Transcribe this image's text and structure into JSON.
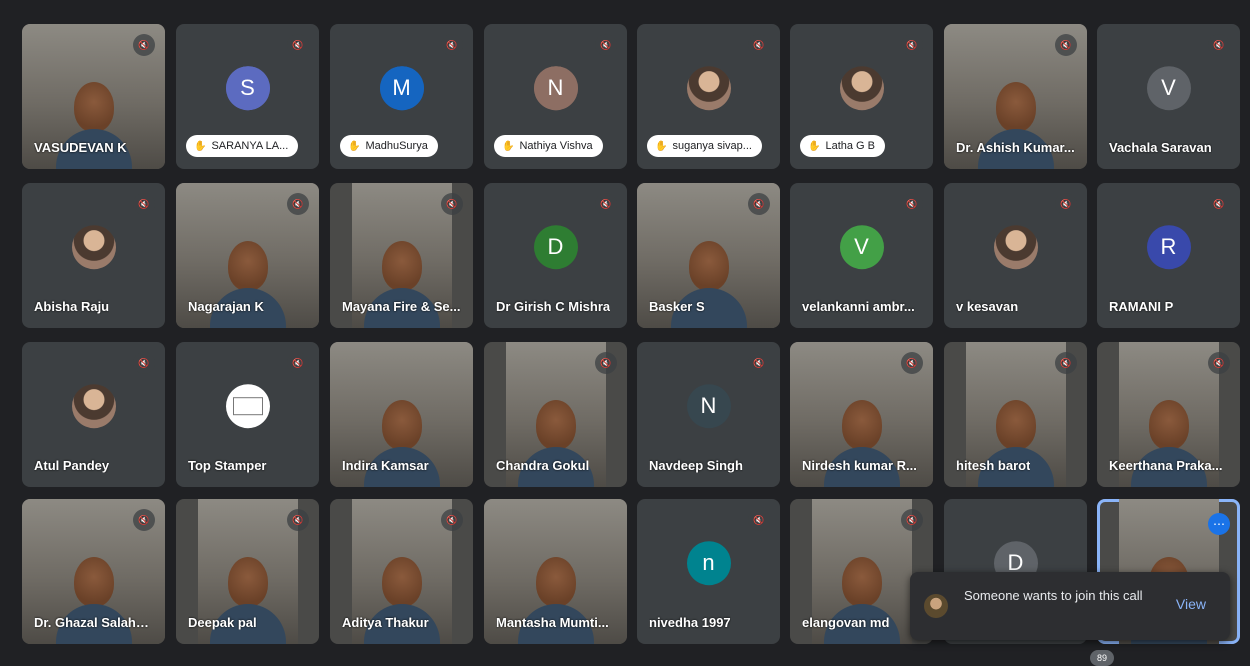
{
  "participants": [
    {
      "name": "VASUDEVAN K",
      "type": "video",
      "muted": true
    },
    {
      "name": "SARANYA LA...",
      "type": "pill",
      "initial": "S",
      "color": "#5c6bc0",
      "muted": true
    },
    {
      "name": "MadhuSurya",
      "type": "pill",
      "initial": "M",
      "color": "#1565c0",
      "muted": true
    },
    {
      "name": "Nathiya Vishva",
      "type": "pill",
      "initial": "N",
      "color": "#8d6e63",
      "muted": true
    },
    {
      "name": "suganya sivap...",
      "type": "pill",
      "avatar": "photo",
      "muted": true
    },
    {
      "name": "Latha G B",
      "type": "pill",
      "avatar": "photo",
      "muted": true
    },
    {
      "name": "Dr. Ashish Kumar...",
      "type": "video",
      "muted": true
    },
    {
      "name": "Vachala Saravan",
      "type": "avatar",
      "initial": "V",
      "color": "#5f6368",
      "muted": true
    },
    {
      "name": "Abisha Raju",
      "type": "avatar",
      "avatar": "photo",
      "muted": true
    },
    {
      "name": "Nagarajan K",
      "type": "video",
      "muted": true
    },
    {
      "name": "Mayana Fire & Se...",
      "type": "video",
      "muted": true
    },
    {
      "name": "Dr Girish C Mishra",
      "type": "avatar",
      "initial": "D",
      "color": "#2e7d32",
      "muted": true
    },
    {
      "name": "Basker S",
      "type": "video",
      "muted": true
    },
    {
      "name": "velankanni ambr...",
      "type": "avatar",
      "initial": "V",
      "color": "#43a047",
      "muted": true
    },
    {
      "name": "v kesavan",
      "type": "avatar",
      "avatar": "photo",
      "muted": true
    },
    {
      "name": "RAMANI P",
      "type": "avatar",
      "initial": "R",
      "color": "#3949ab",
      "muted": true
    },
    {
      "name": "Atul Pandey",
      "type": "avatar",
      "avatar": "photo",
      "muted": true
    },
    {
      "name": "Top Stamper",
      "type": "avatar",
      "avatar": "stamp",
      "muted": true
    },
    {
      "name": "Indira Kamsar",
      "type": "video",
      "muted": false
    },
    {
      "name": "Chandra Gokul",
      "type": "video",
      "muted": true
    },
    {
      "name": "Navdeep Singh",
      "type": "avatar",
      "initial": "N",
      "color": "#37474f",
      "muted": true
    },
    {
      "name": "Nirdesh kumar R...",
      "type": "video",
      "muted": true
    },
    {
      "name": "hitesh barot",
      "type": "video",
      "muted": true
    },
    {
      "name": "Keerthana Praka...",
      "type": "video",
      "muted": true
    },
    {
      "name": "Dr. Ghazal Salahu...",
      "type": "video",
      "muted": true
    },
    {
      "name": "Deepak pal",
      "type": "video",
      "muted": true
    },
    {
      "name": "Aditya Thakur",
      "type": "video",
      "muted": true
    },
    {
      "name": "Mantasha Mumti...",
      "type": "video",
      "muted": false
    },
    {
      "name": "nivedha 1997",
      "type": "avatar",
      "initial": "n",
      "color": "#00838f",
      "muted": true
    },
    {
      "name": "elangovan md",
      "type": "video",
      "muted": true
    },
    {
      "name": "",
      "type": "avatar",
      "initial": "D",
      "color": "#5f6368",
      "muted": false
    },
    {
      "name": "",
      "type": "video",
      "muted": false,
      "active": true
    }
  ],
  "join_toast": {
    "message": "Someone wants to join this call",
    "action": "View"
  },
  "participant_count": "89",
  "more_options_icon": "more-horiz-icon"
}
